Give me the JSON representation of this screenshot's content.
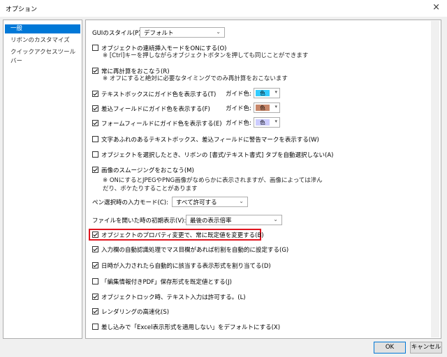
{
  "window": {
    "title": "オプション",
    "close": "×"
  },
  "sidebar": {
    "items": [
      {
        "label": "一般",
        "selected": true
      },
      {
        "label": "リボンのカスタマイズ",
        "selected": false
      },
      {
        "label": "クイックアクセスツールバー",
        "selected": false
      }
    ]
  },
  "options": {
    "gui_style": {
      "label": "GUIのスタイル(P):",
      "value": "デフォルト"
    },
    "continuous_insert": {
      "label": "オブジェクトの連続挿入モードをONにする(O)",
      "checked": false,
      "note": "※ [Ctrl]キーを押しながらオブジェクトボタンを押しても同じことができます"
    },
    "always_recalc": {
      "label": "常に再計算をおこなう(R)",
      "checked": true,
      "note": "※ オフにすると絶対に必要なタイミングでのみ再計算をおこないます"
    },
    "textbox_guide": {
      "label": "テキストボックスにガイド色を表示する(T)",
      "checked": true,
      "color_label": "ガイド色:",
      "color_text": "色",
      "color": "#33ccff"
    },
    "merge_field_guide": {
      "label": "差込フィールドにガイド色を表示する(F)",
      "checked": true,
      "color_label": "ガイド色:",
      "color_text": "色",
      "color": "#c8876a"
    },
    "form_field_guide": {
      "label": "フォームフィールドにガイド色を表示する(E)",
      "checked": true,
      "color_label": "ガイド色:",
      "color_text": "色",
      "color": "#ccccff"
    },
    "overflow_warning": {
      "label": "文字あふれのあるテキストボックス、差込フィールドに警告マークを表示する(W)",
      "checked": false
    },
    "auto_select_tab": {
      "label": "オブジェクトを選択したとき、リボンの [書式/テキスト書式] タブを自動選択しない(A)",
      "checked": false
    },
    "image_smoothing": {
      "label": "画像のスムージングをおこなう(M)",
      "checked": true,
      "note": "※ ONにするとJPEGやPNG画像がなめらかに表示されますが、画像によっては滲んだり、ボケたりすることがあります"
    },
    "pen_mode": {
      "label": "ペン選択時の入力モード(C):",
      "value": "すべて許可する"
    },
    "initial_zoom": {
      "label": "ファイルを開いた時の初期表示(V):",
      "value": "最後の表示倍率"
    },
    "property_default": {
      "label": "オブジェクトのプロパティ変更で、常に既定値を変更する(B)",
      "checked": true
    },
    "auto_recognize": {
      "label": "入力欄の自動認識処理でマス目欄があれば桁割を自動的に設定する(G)",
      "checked": true
    },
    "date_format": {
      "label": "日時が入力されたら自動的に該当する表示形式を割り当てる(D)",
      "checked": true
    },
    "pdf_default": {
      "label": "「編集情報付きPDF」保存形式を既定値とする(J)",
      "checked": false
    },
    "lock_text_input": {
      "label": "オブジェクトロック時、テキスト入力は許可する。(L)",
      "checked": true
    },
    "fast_render": {
      "label": "レンダリングの高速化(S)",
      "checked": true
    },
    "excel_format": {
      "label": "差し込みで「Excel表示形式を適用しない」をデフォルトにする(X)",
      "checked": false
    }
  },
  "buttons": {
    "ok": "OK",
    "cancel": "キャンセル"
  },
  "icons": {
    "dropdown": "chevron-down-icon",
    "checkmark": "checkmark-icon"
  }
}
